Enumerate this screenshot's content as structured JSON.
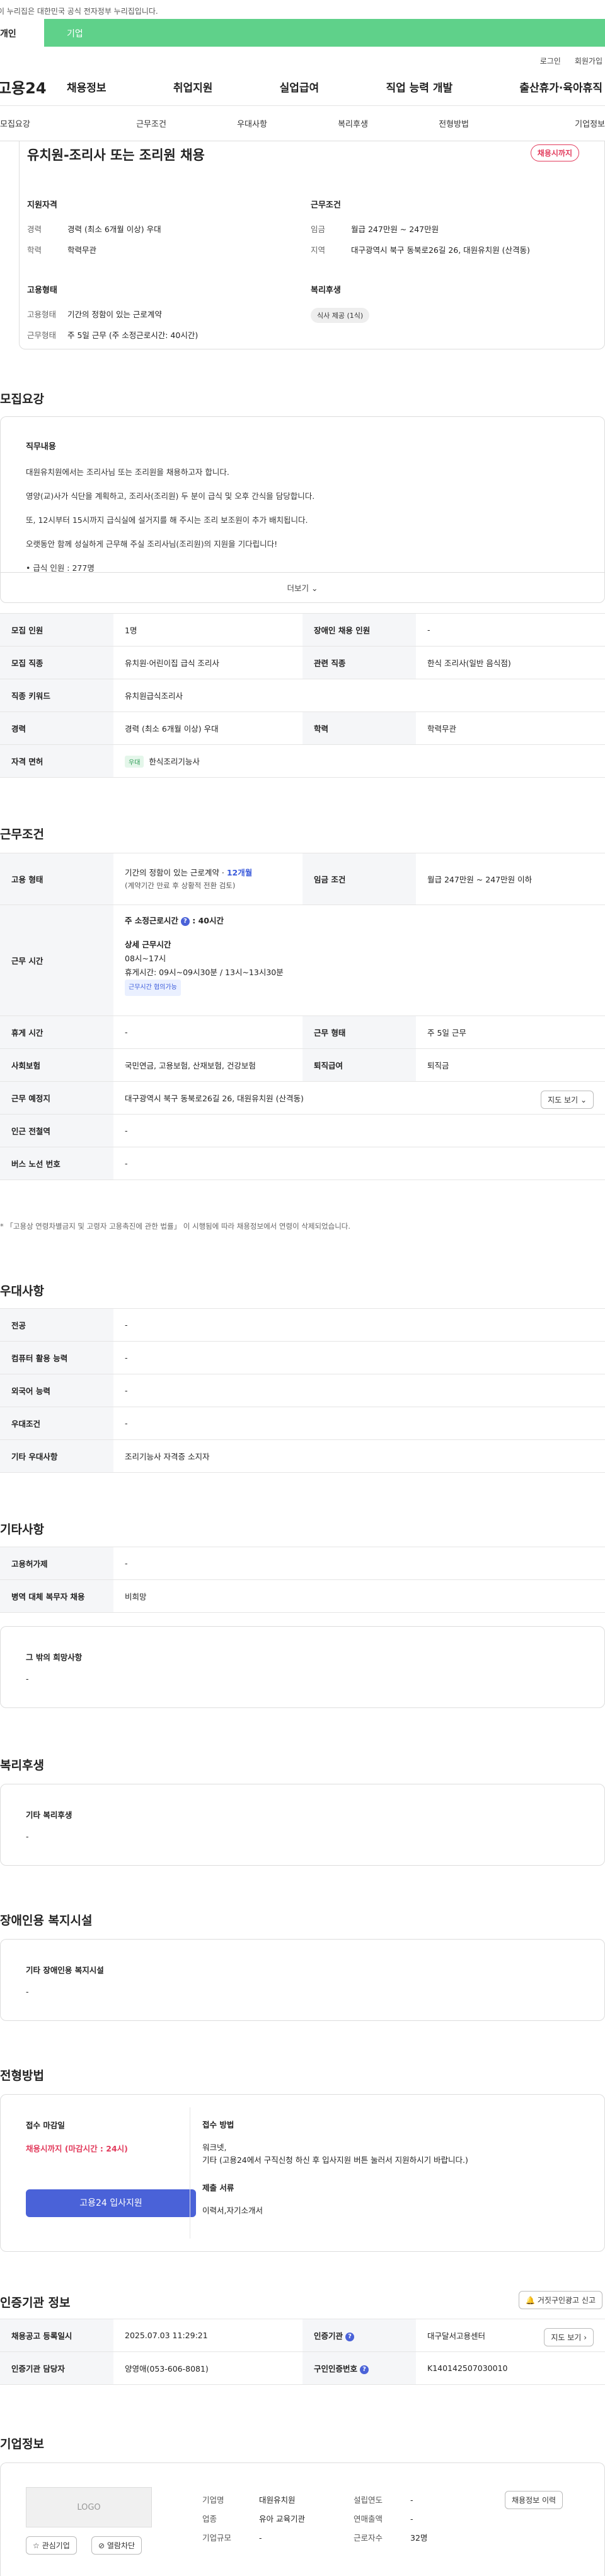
{
  "gov_bar": {
    "text": "이 누리집은 대한민국 공식 전자정부 누리집입니다."
  },
  "top_tabs": {
    "personal": "개인",
    "company": "기업"
  },
  "util": {
    "login": "로그인",
    "join": "회원가입"
  },
  "gnb": {
    "logo": "고용24",
    "menu": [
      "채용정보",
      "취업지원",
      "실업급여",
      "직업 능력 개발",
      "출산휴가·육아휴직"
    ]
  },
  "subnav": [
    "모집요강",
    "근무조건",
    "우대사항",
    "복리후생",
    "전형방법",
    "기업정보"
  ],
  "summary": {
    "title": "유치원-조리사 또는 조리원 채용",
    "badge": "채용시까지",
    "qual_title": "지원자격",
    "qual": [
      {
        "k": "경력",
        "v": "경력 (최소 6개월 이상) 우대"
      },
      {
        "k": "학력",
        "v": "학력무관"
      }
    ],
    "cond_title": "근무조건",
    "cond": [
      {
        "k": "임금",
        "v": "월급 247만원 ~ 247만원"
      },
      {
        "k": "지역",
        "v": "대구광역시 북구 동북로26길 26, 대원유치원 (산격동)"
      }
    ],
    "emp_title": "고용형태",
    "emp": [
      {
        "k": "고용형태",
        "v": "기간의 정함이 있는 근로계약"
      },
      {
        "k": "근무형태",
        "v": "주 5일 근무 (주 소정근로시간: 40시간)"
      }
    ],
    "welfare_title": "복리후생",
    "welfare_chip": "식사 제공 (1식)"
  },
  "recruit": {
    "title": "모집요강",
    "duty_title": "직무내용",
    "lines": [
      "대원유치원에서는 조리사님 또는 조리원을 채용하고자 합니다.",
      "영양(교)사가 식단을 계획하고, 조리사(조리원) 두 분이 급식 및 오후 간식을 담당합니다.",
      "또, 12시부터 15시까지 급식실에 설거지를 해 주시는 조리 보조원이 추가 배치됩니다.",
      "오랫동안 함께 성실하게 근무해 주실 조리사님(조리원)의 지원을 기다립니다!",
      "• 급식 인원 : 277명"
    ],
    "more": "더보기",
    "table": {
      "r1": {
        "h1": "모집 인원",
        "v1": "1명",
        "h2": "장애인 채용 인원",
        "v2": "-"
      },
      "r2": {
        "h1": "모집 직종",
        "v1": "유치원·어린이집 급식 조리사",
        "h2": "관련 직종",
        "v2": "한식 조리사(일반 음식점)"
      },
      "r3": {
        "h1": "직종 키워드",
        "v1": "유치원급식조리사"
      },
      "r4": {
        "h1": "경력",
        "v1": "경력 (최소 6개월 이상) 우대",
        "h2": "학력",
        "v2": "학력무관"
      },
      "r5": {
        "h1": "자격 면허",
        "chip": "우대",
        "v1": "한식조리기능사"
      }
    }
  },
  "work": {
    "title": "근무조건",
    "emp_h": "고용 형태",
    "emp_v1_a": "기간의 정함이 있는 근로계약 · ",
    "emp_v1_b": "12개월",
    "emp_v2": "(계약기간 만료 후 상황적 전환 검토)",
    "wage_h": "임금 조건",
    "wage_v": "월급 247만원 ~ 247만원 이하",
    "time_h": "근무 시간",
    "time_week_a": "주 소정근로시간",
    "time_week_b": "40시간",
    "time_detail_title": "상세 근무시간",
    "time_detail_1": "08시~17시",
    "time_detail_2": "휴게시간: 09시~09시30분 / 13시~13시30분",
    "time_chip": "근무시간 협의가능",
    "rest_h": "휴게 시간",
    "rest_v": "-",
    "form_h": "근무 형태",
    "form_v": "주 5일 근무",
    "ins_h": "사회보험",
    "ins_v": "국민연금, 고용보험, 산재보험, 건강보험",
    "sev_h": "퇴직급여",
    "sev_v": "퇴직금",
    "place_h": "근무 예정지",
    "place_v": "대구광역시 북구 동북로26길 26, 대원유치원 (산격동)",
    "map_btn": "지도 보기",
    "station_h": "인근 전철역",
    "station_v": "-",
    "bus_h": "버스 노선 번호",
    "bus_v": "-",
    "note": "* 「고용상 연령차별금지 및 고령자 고용촉진에 관한 법률」 이 시행됨에 따라 채용정보에서 연령이 삭제되었습니다."
  },
  "pref": {
    "title": "우대사항",
    "rows": [
      {
        "h": "전공",
        "v": "-"
      },
      {
        "h": "컴퓨터 활용 능력",
        "v": "-"
      },
      {
        "h": "외국어 능력",
        "v": "-"
      },
      {
        "h": "우대조건",
        "v": "-"
      },
      {
        "h": "기타 우대사항",
        "v": "조리기능사 자격증 소지자"
      }
    ]
  },
  "etc": {
    "title": "기타사항",
    "rows": [
      {
        "h": "고용허가제",
        "v": "-"
      },
      {
        "h": "병역 대체 복무자 채용",
        "v": "비희망"
      }
    ],
    "box_title": "그 밖의 희망사항",
    "box_v": "-"
  },
  "welfare": {
    "title": "복리후생",
    "box_title": "기타 복리후생",
    "box_v": "-"
  },
  "disabled": {
    "title": "장애인용 복지시설",
    "box_title": "기타 장애인용 복지시설",
    "box_v": "-"
  },
  "apply": {
    "title": "전형방법",
    "deadline_title": "접수 마감일",
    "deadline_v": "채용시까지 (마감시간 : 24시)",
    "apply_btn": "고용24 입사지원",
    "method_title": "접수 방법",
    "method_v1": "워크넷,",
    "method_v2": "기타 (고용24에서 구직신청 하신 후 입사지원 버튼 눌러서 지원하시기 바랍니다.)",
    "docs_title": "제출 서류",
    "docs_v": "이력서,자기소개서"
  },
  "cert": {
    "title": "인증기관 정보",
    "report_btn": "거짓구인광고 신고",
    "reg_h": "채용공고 등록일시",
    "reg_v": "2025.07.03 11:29:21",
    "org_h": "인증기관",
    "org_v": "대구달서고용센터",
    "map_btn": "지도 보기",
    "staff_h": "인증기관 담당자",
    "staff_v": "양영애(053-606-8081)",
    "num_h": "구인인증번호",
    "num_v": "K140142507030010"
  },
  "company": {
    "title": "기업정보",
    "logo_text": "LOGO",
    "fav_btn": "관심기업",
    "block_btn": "열람차단",
    "name_k": "기업명",
    "name_v": "대원유치원",
    "ind_k": "업종",
    "ind_v": "유아 교육기관",
    "size_k": "기업규모",
    "size_v": "-",
    "year_k": "설립연도",
    "year_v": "-",
    "sales_k": "연매출액",
    "sales_v": "-",
    "emp_k": "근로자수",
    "emp_v": "32명",
    "history_btn": "채용정보 이력"
  }
}
